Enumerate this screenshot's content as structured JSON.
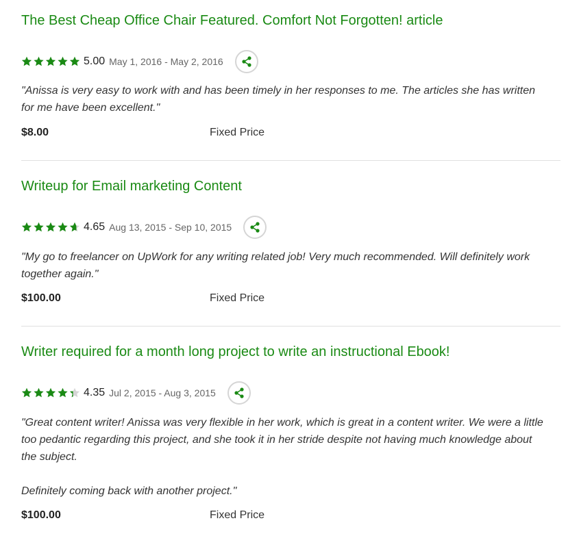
{
  "colors": {
    "accent": "#1a8a14",
    "star": "#1a8a14",
    "star_empty": "#d5d5d5",
    "divider": "#e0e0e0"
  },
  "icons": {
    "star": "star-icon",
    "share": "share-icon"
  },
  "reviews": [
    {
      "title": "The Best Cheap Office Chair Featured. Comfort Not Forgotten! article",
      "rating": 5.0,
      "score_text": "5.00",
      "dates": "May 1, 2016 - May 2, 2016",
      "quote_paragraphs": [
        "\"Anissa is very easy to work with and has been timely in her responses to me. The articles she has written for me have been excellent.\""
      ],
      "amount": "$8.00",
      "price_type": "Fixed Price"
    },
    {
      "title": "Writeup for Email marketing Content",
      "rating": 4.65,
      "score_text": "4.65",
      "dates": "Aug 13, 2015 - Sep 10, 2015",
      "quote_paragraphs": [
        "\"My go to freelancer on UpWork for any writing related job! Very much recommended. Will definitely work together again.\""
      ],
      "amount": "$100.00",
      "price_type": "Fixed Price"
    },
    {
      "title": "Writer required for a month long project to write an instructional Ebook!",
      "rating": 4.35,
      "score_text": "4.35",
      "dates": "Jul 2, 2015 - Aug 3, 2015",
      "quote_paragraphs": [
        "\"Great content writer! Anissa was very flexible in her work, which is great in a content writer. We were a little too pedantic regarding this project, and she took it in her stride despite not having much knowledge about the subject.",
        "Definitely coming back with another project.\""
      ],
      "amount": "$100.00",
      "price_type": "Fixed Price"
    }
  ]
}
